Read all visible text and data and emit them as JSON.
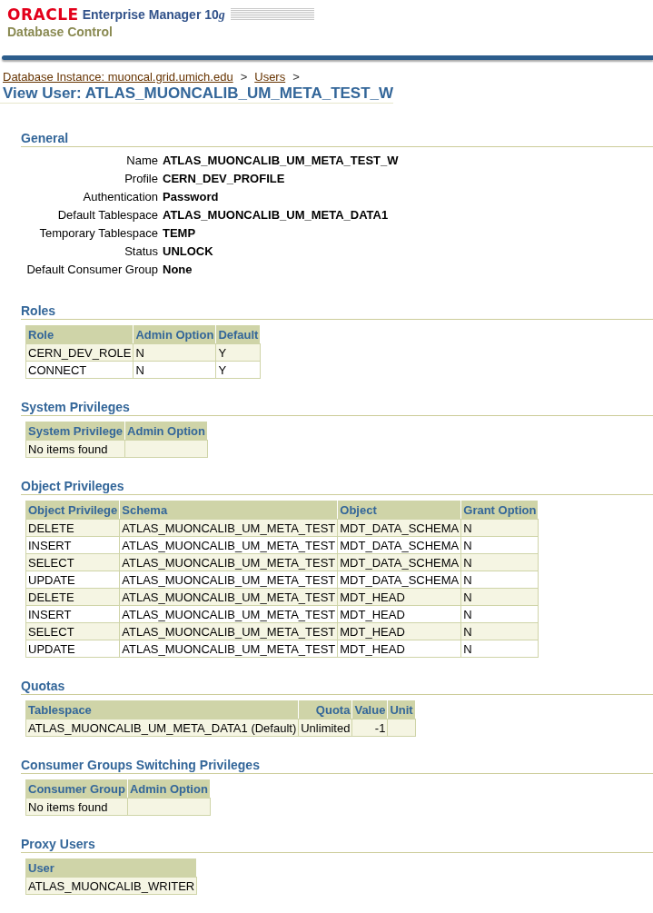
{
  "branding": {
    "logo": "ORACLE",
    "product": "Enterprise Manager 10",
    "product_suffix": "g",
    "subtitle": "Database Control"
  },
  "breadcrumbs": [
    {
      "label": "Database Instance: muoncal.grid.umich.edu"
    },
    {
      "label": "Users"
    }
  ],
  "breadcrumb_separator": ">",
  "page_title": "View User: ATLAS_MUONCALIB_UM_META_TEST_W",
  "sections": [
    {
      "kind": "properties",
      "title": "General",
      "properties": [
        {
          "label": "Name",
          "value": "ATLAS_MUONCALIB_UM_META_TEST_W"
        },
        {
          "label": "Profile",
          "value": "CERN_DEV_PROFILE"
        },
        {
          "label": "Authentication",
          "value": "Password"
        },
        {
          "label": "Default Tablespace",
          "value": "ATLAS_MUONCALIB_UM_META_DATA1"
        },
        {
          "label": "Temporary Tablespace",
          "value": "TEMP"
        },
        {
          "label": "Status",
          "value": "UNLOCK"
        },
        {
          "label": "Default Consumer Group",
          "value": "None"
        }
      ]
    },
    {
      "kind": "table",
      "title": "Roles",
      "columns": [
        {
          "label": "Role",
          "kind": "text"
        },
        {
          "label": "Admin Option",
          "kind": "text"
        },
        {
          "label": "Default",
          "kind": "text"
        }
      ],
      "rows": [
        [
          "CERN_DEV_ROLE",
          "N",
          "Y"
        ],
        [
          "CONNECT",
          "N",
          "Y"
        ]
      ]
    },
    {
      "kind": "table",
      "title": "System Privileges",
      "columns": [
        {
          "label": "System Privilege",
          "kind": "text"
        },
        {
          "label": "Admin Option",
          "kind": "text"
        }
      ],
      "empty_message": "No items found"
    },
    {
      "kind": "table",
      "title": "Object Privileges",
      "columns": [
        {
          "label": "Object Privilege",
          "kind": "text"
        },
        {
          "label": "Schema",
          "kind": "text"
        },
        {
          "label": "Object",
          "kind": "text"
        },
        {
          "label": "Grant Option",
          "kind": "text"
        }
      ],
      "rows": [
        [
          "DELETE",
          "ATLAS_MUONCALIB_UM_META_TEST",
          "MDT_DATA_SCHEMA",
          "N"
        ],
        [
          "INSERT",
          "ATLAS_MUONCALIB_UM_META_TEST",
          "MDT_DATA_SCHEMA",
          "N"
        ],
        [
          "SELECT",
          "ATLAS_MUONCALIB_UM_META_TEST",
          "MDT_DATA_SCHEMA",
          "N"
        ],
        [
          "UPDATE",
          "ATLAS_MUONCALIB_UM_META_TEST",
          "MDT_DATA_SCHEMA",
          "N"
        ],
        [
          "DELETE",
          "ATLAS_MUONCALIB_UM_META_TEST",
          "MDT_HEAD",
          "N"
        ],
        [
          "INSERT",
          "ATLAS_MUONCALIB_UM_META_TEST",
          "MDT_HEAD",
          "N"
        ],
        [
          "SELECT",
          "ATLAS_MUONCALIB_UM_META_TEST",
          "MDT_HEAD",
          "N"
        ],
        [
          "UPDATE",
          "ATLAS_MUONCALIB_UM_META_TEST",
          "MDT_HEAD",
          "N"
        ]
      ]
    },
    {
      "kind": "table",
      "title": "Quotas",
      "columns": [
        {
          "label": "Tablespace",
          "kind": "text"
        },
        {
          "label": "Quota",
          "kind": "number"
        },
        {
          "label": "Value",
          "kind": "number"
        },
        {
          "label": "Unit",
          "kind": "text"
        }
      ],
      "rows": [
        [
          "ATLAS_MUONCALIB_UM_META_DATA1 (Default)",
          "Unlimited",
          "-1",
          null
        ]
      ]
    },
    {
      "kind": "table",
      "title": "Consumer Groups Switching Privileges",
      "columns": [
        {
          "label": "Consumer Group",
          "kind": "text"
        },
        {
          "label": "Admin Option",
          "kind": "text"
        }
      ],
      "empty_message": "No items found"
    },
    {
      "kind": "table",
      "title": "Proxy Users",
      "columns": [
        {
          "label": "User",
          "kind": "text"
        }
      ],
      "rows": [
        [
          "ATLAS_MUONCALIB_WRITER"
        ]
      ]
    }
  ]
}
